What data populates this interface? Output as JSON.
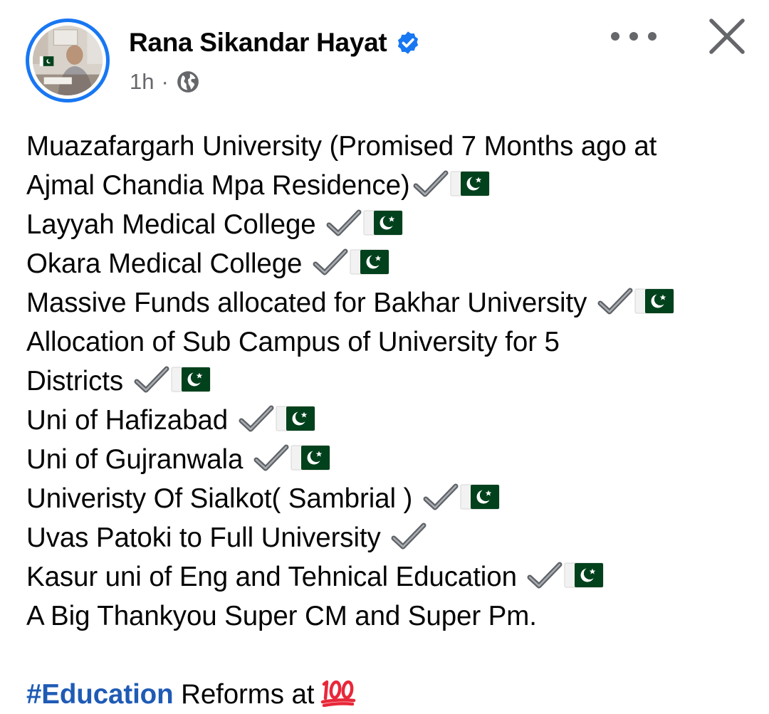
{
  "header": {
    "author_name": "Rana Sikandar Hayat",
    "timestamp": "1h",
    "separator": "·",
    "verified_icon": "verified-badge-icon",
    "audience_icon": "globe-icon",
    "more_icon": "more-options-icon",
    "close_icon": "close-icon"
  },
  "post": {
    "lines": [
      {
        "text": "Muazafargarh University (Promised 7 Months ago at",
        "check": false,
        "flag": false
      },
      {
        "text": "Ajmal Chandia Mpa Residence)",
        "check": true,
        "flag": true
      },
      {
        "text": "Layyah Medical College ",
        "check": true,
        "flag": true
      },
      {
        "text": "Okara Medical College ",
        "check": true,
        "flag": true
      },
      {
        "text": "Massive Funds allocated for Bakhar University ",
        "check": true,
        "flag": true
      },
      {
        "text": "Allocation of Sub Campus of University for 5",
        "check": false,
        "flag": false
      },
      {
        "text": "Districts ",
        "check": true,
        "flag": true
      },
      {
        "text": "Uni of Hafizabad ",
        "check": true,
        "flag": true
      },
      {
        "text": "Uni of Gujranwala ",
        "check": true,
        "flag": true
      },
      {
        "text": "Univeristy Of Sialkot( Sambrial ) ",
        "check": true,
        "flag": true
      },
      {
        "text": "Uvas Patoki to Full University ",
        "check": true,
        "flag": false
      },
      {
        "text": "Kasur uni of Eng and Tehnical Education ",
        "check": true,
        "flag": true
      },
      {
        "text": "A Big Thankyou Super CM and Super Pm.",
        "check": false,
        "flag": false
      }
    ],
    "hashtag": "#Education",
    "closing_text": " Reforms at",
    "closing_emoji": "hundred-points-icon"
  },
  "colors": {
    "brand_blue": "#1877f2",
    "hashtag_blue": "#1f5bb5",
    "text": "#050505",
    "secondary_text": "#65676b",
    "flag_green": "#01411c"
  }
}
